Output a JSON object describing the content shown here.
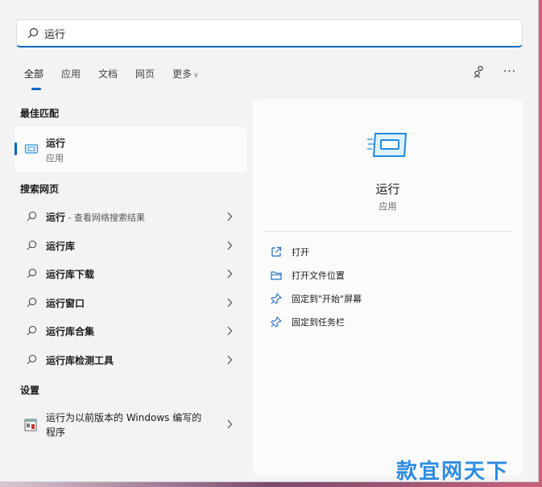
{
  "search": {
    "value": "运行"
  },
  "tabs": [
    {
      "label": "全部",
      "active": true
    },
    {
      "label": "应用"
    },
    {
      "label": "文档"
    },
    {
      "label": "网页"
    },
    {
      "label": "更多"
    }
  ],
  "sections": {
    "best_match": "最佳匹配",
    "web": "搜索网页",
    "settings": "设置"
  },
  "best_match": {
    "title": "运行",
    "subtitle": "应用"
  },
  "web_results": [
    {
      "label": "运行",
      "suffix": " - 查看网络搜索结果"
    },
    {
      "label": "运行库"
    },
    {
      "label": "运行库下载"
    },
    {
      "label": "运行窗口"
    },
    {
      "label": "运行库合集"
    },
    {
      "label": "运行库检测工具"
    }
  ],
  "setting_result": {
    "label": "运行为以前版本的 Windows 编写的程序"
  },
  "detail": {
    "title": "运行",
    "subtitle": "应用",
    "actions": [
      {
        "label": "打开",
        "icon": "open-external-icon"
      },
      {
        "label": "打开文件位置",
        "icon": "folder-icon"
      },
      {
        "label": "固定到\"开始\"屏幕",
        "icon": "pin-icon"
      },
      {
        "label": "固定到任务栏",
        "icon": "pin-icon"
      }
    ]
  },
  "watermark": "款宜网天下",
  "colors": {
    "accent": "#0067c0",
    "icon_blue": "#3aa0e8"
  }
}
